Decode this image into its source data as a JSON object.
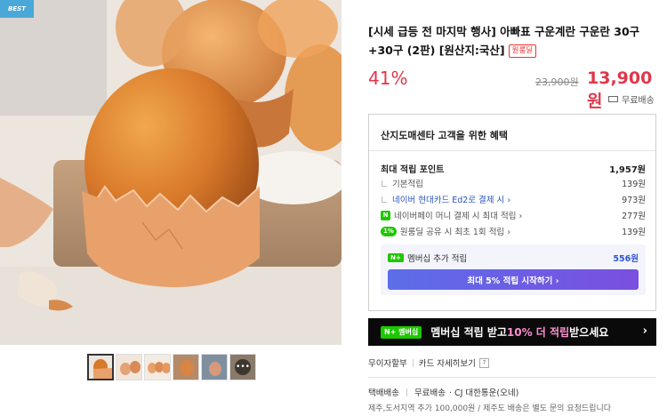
{
  "gallery": {
    "badge": "BEST",
    "main_image_alt": "egg-photo",
    "more_label": "•••",
    "thumbnails": [
      "egg-thumb-1",
      "egg-thumb-2",
      "egg-thumb-3",
      "egg-thumb-4",
      "egg-thumb-5",
      "egg-thumb-more"
    ]
  },
  "product": {
    "title": "[시세 급등 전 마지막 행사] 아빠표 구운계란 구운란 30구+30구 (2판) [원산지:국산]",
    "origin_badge": "원룸딜",
    "discount": "41%",
    "original_price": "23,900원",
    "sale_price": "13,900원",
    "shipping": "무료배송"
  },
  "benefits": {
    "title": "산지도매센타 고객을 위한 혜택",
    "max_points_label": "최대 적립 포인트",
    "max_points_value": "1,957원",
    "rows": [
      {
        "label": "기본적립",
        "value": "139원"
      },
      {
        "label": "네이버 현대카드 Ed2로 결제 시 ›",
        "value": "973원"
      },
      {
        "label": "네이버페이 머니 결제 시 최대 적립 ›",
        "value": "277원"
      },
      {
        "label": "원룸딜 공유 시 최초 1회 적립 ›",
        "value": "139원"
      }
    ],
    "npay_icon": "N",
    "share_icon": "1%",
    "membership_icon": "N+",
    "membership_label": "멤버십 추가 적립",
    "membership_value": "556원",
    "membership_button": "최대 5% 적립 시작하기 ›"
  },
  "promo": {
    "badge": "N+ 멤버십",
    "text_1": "멤버십 적립 받고 ",
    "text_accent": "10% 더 적립",
    "text_2": " 받으세요",
    "chevron": "›"
  },
  "payment": {
    "installment": "무이자할부",
    "card_detail": "카드 자세히보기",
    "help": "?"
  },
  "delivery": {
    "type": "택배배송",
    "fee": "무료배송",
    "carrier": "· CJ 대한통운(오네)",
    "note": "제주,도서지역 추가 100,000원 / 제주도 배송은 별도 문의 요청드립니다"
  },
  "colors": {
    "accent_red": "#e0374a",
    "naver_green": "#1ec800",
    "member_blue": "#2f55d4",
    "badge_blue": "#4aa8d8"
  }
}
